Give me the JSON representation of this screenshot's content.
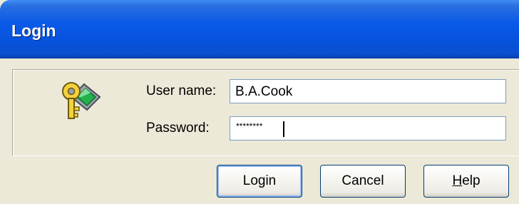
{
  "window": {
    "title": "Login"
  },
  "form": {
    "username_label": "User name:",
    "username_value": "B.A.Cook",
    "password_label": "Password:",
    "password_value": "********"
  },
  "buttons": {
    "login": "Login",
    "cancel": "Cancel",
    "help_mnemonic": "H",
    "help_rest": "elp"
  },
  "icons": {
    "login_icon": "key-icon"
  },
  "colors": {
    "titlebar": "#0a5ae8",
    "dialog_background": "#ece9d8",
    "button_border": "#003c74",
    "default_button_glow": "#8cb4f2"
  }
}
